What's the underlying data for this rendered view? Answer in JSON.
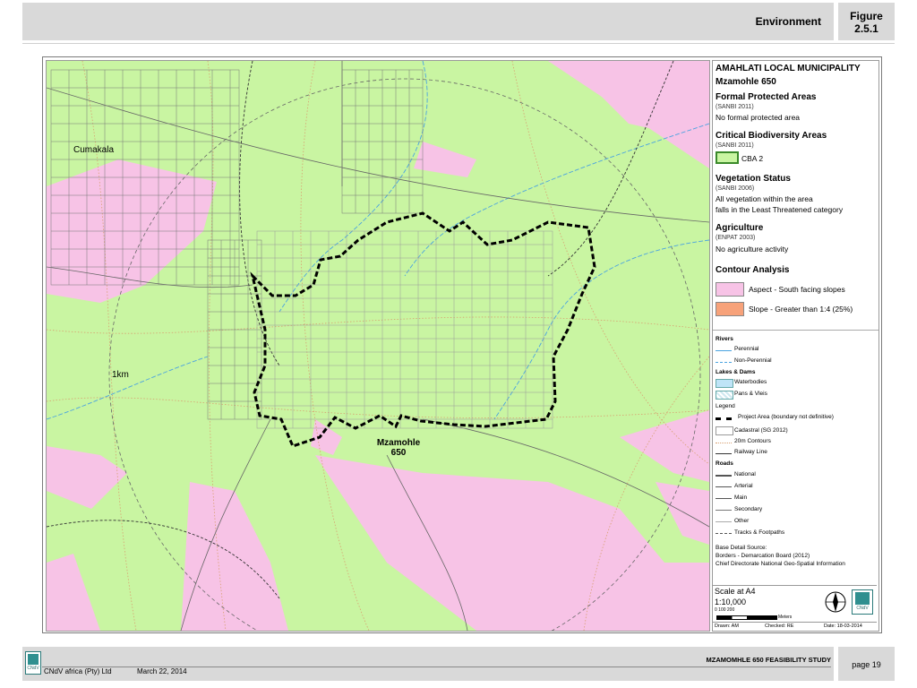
{
  "header": {
    "title": "Environment",
    "figure_line1": "Figure",
    "figure_line2": "2.5.1"
  },
  "map": {
    "labels": {
      "town": "Cumakala",
      "distance": "1km",
      "site_line1": "Mzamohle",
      "site_line2": "650"
    },
    "colors": {
      "background": "#c9f5a2",
      "aspect": "#f7c3e6",
      "slope": "#f7a27a",
      "perennial": "#4aa3e0",
      "roads": "#555555",
      "boundary": "#000000"
    }
  },
  "legend": {
    "municipality": "AMAHLATI LOCAL MUNICIPALITY",
    "project": "Mzamohle 650",
    "formal_title": "Formal Protected Areas",
    "formal_source": "(SANBI 2011)",
    "formal_text": "No formal protected area",
    "cba_title": "Critical Biodiversity Areas",
    "cba_source": "(SANBI 2011)",
    "cba_item": "CBA 2",
    "veg_title": "Vegetation Status",
    "veg_source": "(SANBI 2006)",
    "veg_text1": "All vegetation within the area",
    "veg_text2": "falls in the Least Threatened category",
    "agri_title": "Agriculture",
    "agri_source": "(ENPAT 2003)",
    "agri_text": "No agriculture activity",
    "contour_title": "Contour Analysis",
    "aspect": "Aspect - South facing slopes",
    "slope": "Slope - Greater than 1:4 (25%)",
    "rivers": "Rivers",
    "perennial": "Perennial",
    "non_perennial": "Non-Perennial",
    "lakes": "Lakes & Dams",
    "waterbodies": "Waterbodies",
    "pans": "Pans & Vleis",
    "legend_word": "Legend",
    "project_area": "Project Area (boundary not definitive)",
    "cadastral": "Cadastral (SG 2012)",
    "contours": "20m Contours",
    "railway": "Railway Line",
    "roads": "Roads",
    "national": "National",
    "arterial": "Arterial",
    "main": "Main",
    "secondary": "Secondary",
    "other": "Other",
    "tracks": "Tracks & Footpaths",
    "source1": "Base Detail Source:",
    "source2": "Borders - Demarcation Board (2012)",
    "source3": "Chief Directorate National Geo-Spatial Information",
    "scale_title": "Scale at A4",
    "scale_ratio": "1:10,000",
    "scale_ticks": "0        100        200",
    "scale_unit": "Meters",
    "drawn": "Drawn: AM",
    "checked": "Checked: RE",
    "date": "Date: 18-03-2014",
    "logo": "CNdV"
  },
  "footer": {
    "study": "MZAMOMHLE 650 FEASIBILITY STUDY",
    "company": "CNdV africa (Pty) Ltd",
    "date": "March 22, 2014",
    "page": "page 19",
    "logo": "CNdV"
  }
}
